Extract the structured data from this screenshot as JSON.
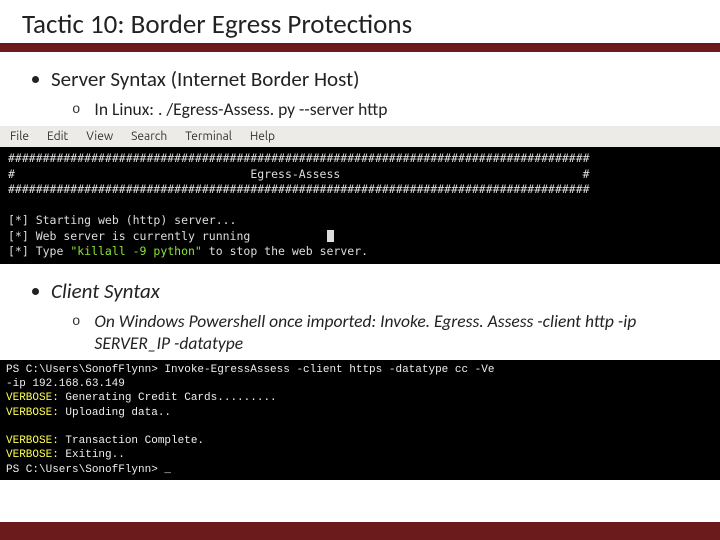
{
  "title": "Tactic 10: Border Egress Protections",
  "bullets": {
    "server": {
      "label": "Server Syntax (Internet Border Host)",
      "sub": "In Linux: . /Egress-Assess. py --server http"
    },
    "client": {
      "label": "Client Syntax",
      "sub": "On Windows Powershell once imported: Invoke. Egress. Assess -client http -ip SERVER_IP -datatype"
    }
  },
  "menubar": [
    "File",
    "Edit",
    "View",
    "Search",
    "Terminal",
    "Help"
  ],
  "term": {
    "hash1": "####################################################################################",
    "banner": "#                                  Egress-Assess                                   #",
    "hash2": "####################################################################################",
    "l1": "[*] Starting web (http) server...",
    "l2": "[*] Web server is currently running",
    "l3p": "[*] Type ",
    "l3c": "\"killall -9 python\"",
    "l3s": " to stop the web server."
  },
  "ps": {
    "l1": "PS C:\\Users\\SonofFlynn> Invoke-EgressAssess -client https -datatype cc -Ve",
    "l2": "-ip 192.168.63.149",
    "v1a": "VERBOSE:",
    "v1b": " Generating Credit Cards.........",
    "v2a": "VERBOSE:",
    "v2b": " Uploading data..",
    "v3a": "VERBOSE:",
    "v3b": " Transaction Complete.",
    "v4a": "VERBOSE:",
    "v4b": " Exiting..",
    "l7": "PS C:\\Users\\SonofFlynn> _"
  }
}
